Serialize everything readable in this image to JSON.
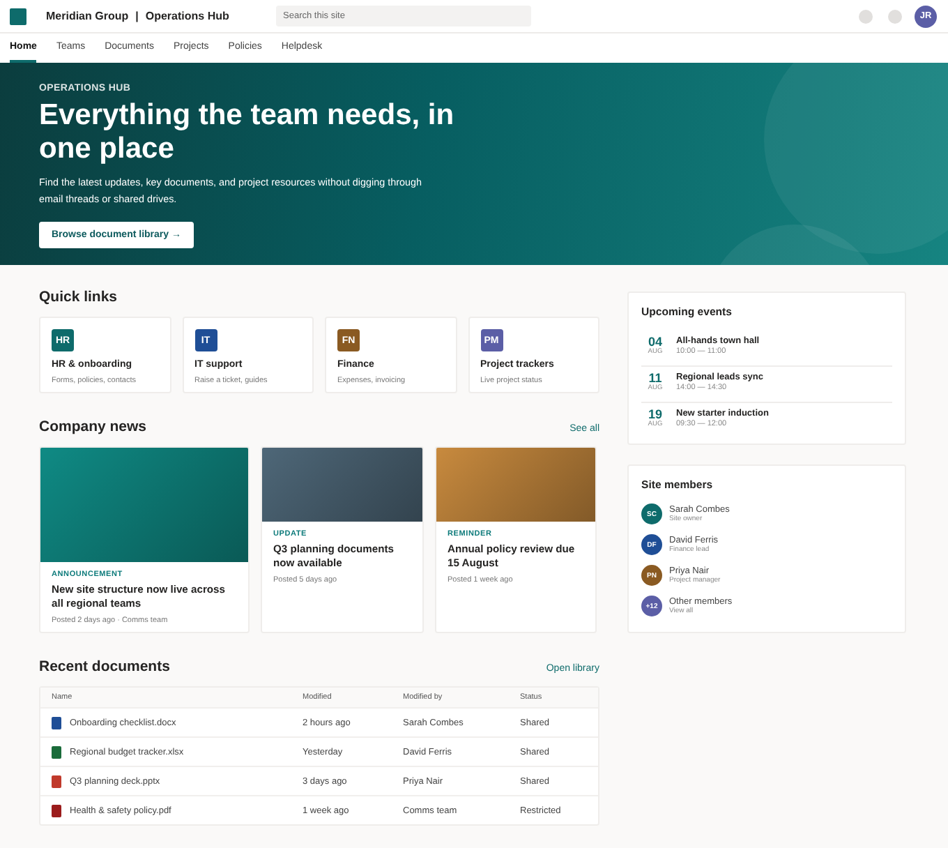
{
  "header": {
    "site": "Meridian Group",
    "separator": "|",
    "hub": "Operations Hub",
    "search": {
      "placeholder": "Search this site"
    },
    "avatar": {
      "initials": "JR",
      "color": "#5b5ea6"
    }
  },
  "nav": [
    {
      "label": "Home",
      "selected": true
    },
    {
      "label": "Teams",
      "selected": false
    },
    {
      "label": "Documents",
      "selected": false
    },
    {
      "label": "Projects",
      "selected": false
    },
    {
      "label": "Policies",
      "selected": false
    },
    {
      "label": "Helpdesk",
      "selected": false
    }
  ],
  "hero": {
    "eyebrow": "OPERATIONS HUB",
    "title": "Everything the team needs, in one place",
    "subtitle": "Find the latest updates, key documents, and project resources without digging through email threads or shared drives.",
    "button": "Browse document library →"
  },
  "quick_links": {
    "title": "Quick links",
    "items": [
      {
        "badge": "HR",
        "color": "#0e6b6b",
        "title": "HR & onboarding",
        "subtitle": "Forms, policies, contacts"
      },
      {
        "badge": "IT",
        "color": "#1f4e96",
        "title": "IT support",
        "subtitle": "Raise a ticket, guides"
      },
      {
        "badge": "FN",
        "color": "#8a5a22",
        "title": "Finance",
        "subtitle": "Expenses, invoicing"
      },
      {
        "badge": "PM",
        "color": "#5b5ea6",
        "title": "Project trackers",
        "subtitle": "Live project status"
      }
    ]
  },
  "news": {
    "title": "Company news",
    "link": "See all",
    "items": [
      {
        "color": "#0f8a84",
        "tag": "ANNOUNCEMENT",
        "title": "New site structure now live across all regional teams",
        "meta": "Posted 2 days ago · Comms team"
      },
      {
        "color": "#4e6778",
        "tag": "UPDATE",
        "title": "Q3 planning documents now available",
        "meta": "Posted 5 days ago"
      },
      {
        "color": "#c88a3e",
        "tag": "REMINDER",
        "title": "Annual policy review due 15 August",
        "meta": "Posted 1 week ago"
      }
    ]
  },
  "documents": {
    "title": "Recent documents",
    "link": "Open library",
    "columns": [
      "Name",
      "Modified",
      "Modified by",
      "Status"
    ],
    "rows": [
      {
        "color": "#1f4e96",
        "cells": [
          "Onboarding checklist.docx",
          "2 hours ago",
          "Sarah Combes",
          "Shared"
        ]
      },
      {
        "color": "#1a6b3a",
        "cells": [
          "Regional budget tracker.xlsx",
          "Yesterday",
          "David Ferris",
          "Shared"
        ]
      },
      {
        "color": "#c0392b",
        "cells": [
          "Q3 planning deck.pptx",
          "3 days ago",
          "Priya Nair",
          "Shared"
        ]
      },
      {
        "color": "#9b1c1c",
        "cells": [
          "Health & safety policy.pdf",
          "1 week ago",
          "Comms team",
          "Restricted"
        ]
      }
    ]
  },
  "events": {
    "title": "Upcoming events",
    "items": [
      {
        "day": "04",
        "month": "AUG",
        "title": "All-hands town hall",
        "time": "10:00 — 11:00"
      },
      {
        "day": "11",
        "month": "AUG",
        "title": "Regional leads sync",
        "time": "14:00 — 14:30"
      },
      {
        "day": "19",
        "month": "AUG",
        "title": "New starter induction",
        "time": "09:30 — 12:00"
      }
    ]
  },
  "members": {
    "title": "Site members",
    "items": [
      {
        "initials": "SC",
        "color": "#0e6b6b",
        "name": "Sarah Combes",
        "role": "Site owner"
      },
      {
        "initials": "DF",
        "color": "#1f4e96",
        "name": "David Ferris",
        "role": "Finance lead"
      },
      {
        "initials": "PN",
        "color": "#8a5a22",
        "name": "Priya Nair",
        "role": "Project manager"
      },
      {
        "initials": "+12",
        "color": "#5b5ea6",
        "name": "Other members",
        "role": "View all"
      }
    ]
  }
}
